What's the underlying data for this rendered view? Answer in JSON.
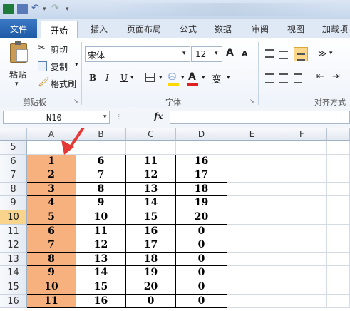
{
  "title_bar": {
    "app_icon": "excel-icon"
  },
  "tabs": [
    "文件",
    "开始",
    "插入",
    "页面布局",
    "公式",
    "数据",
    "审阅",
    "视图",
    "加载项"
  ],
  "clipboard": {
    "paste": "粘贴",
    "cut": "剪切",
    "copy": "复制",
    "format_painter": "格式刷",
    "group": "剪贴板"
  },
  "font": {
    "name": "宋体",
    "size": "12",
    "bold": "B",
    "italic": "I",
    "underline": "U",
    "grow": "A",
    "shrink": "A",
    "font_color": "A",
    "phonetic": "变",
    "group": "字体"
  },
  "alignment": {
    "group": "对齐方式"
  },
  "formula_bar": {
    "name_box": "N10",
    "fx": "fx",
    "value": ""
  },
  "columns": [
    "A",
    "B",
    "C",
    "D",
    "E",
    "F"
  ],
  "rows": [
    {
      "num": "5",
      "cells": [
        "",
        "",
        "",
        ""
      ]
    },
    {
      "num": "6",
      "cells": [
        "1",
        "6",
        "11",
        "16"
      ]
    },
    {
      "num": "7",
      "cells": [
        "2",
        "7",
        "12",
        "17"
      ]
    },
    {
      "num": "8",
      "cells": [
        "3",
        "8",
        "13",
        "18"
      ]
    },
    {
      "num": "9",
      "cells": [
        "4",
        "9",
        "14",
        "19"
      ]
    },
    {
      "num": "10",
      "cells": [
        "5",
        "10",
        "15",
        "20"
      ]
    },
    {
      "num": "11",
      "cells": [
        "6",
        "11",
        "16",
        "0"
      ]
    },
    {
      "num": "12",
      "cells": [
        "7",
        "12",
        "17",
        "0"
      ]
    },
    {
      "num": "13",
      "cells": [
        "8",
        "13",
        "18",
        "0"
      ]
    },
    {
      "num": "14",
      "cells": [
        "9",
        "14",
        "19",
        "0"
      ]
    },
    {
      "num": "15",
      "cells": [
        "10",
        "15",
        "20",
        "0"
      ]
    },
    {
      "num": "16",
      "cells": [
        "11",
        "16",
        "0",
        "0"
      ]
    }
  ],
  "colors": {
    "accent_cell": "#f6b17f",
    "selected_row": "#f9d48c",
    "annotation_arrow": "#e53935"
  }
}
